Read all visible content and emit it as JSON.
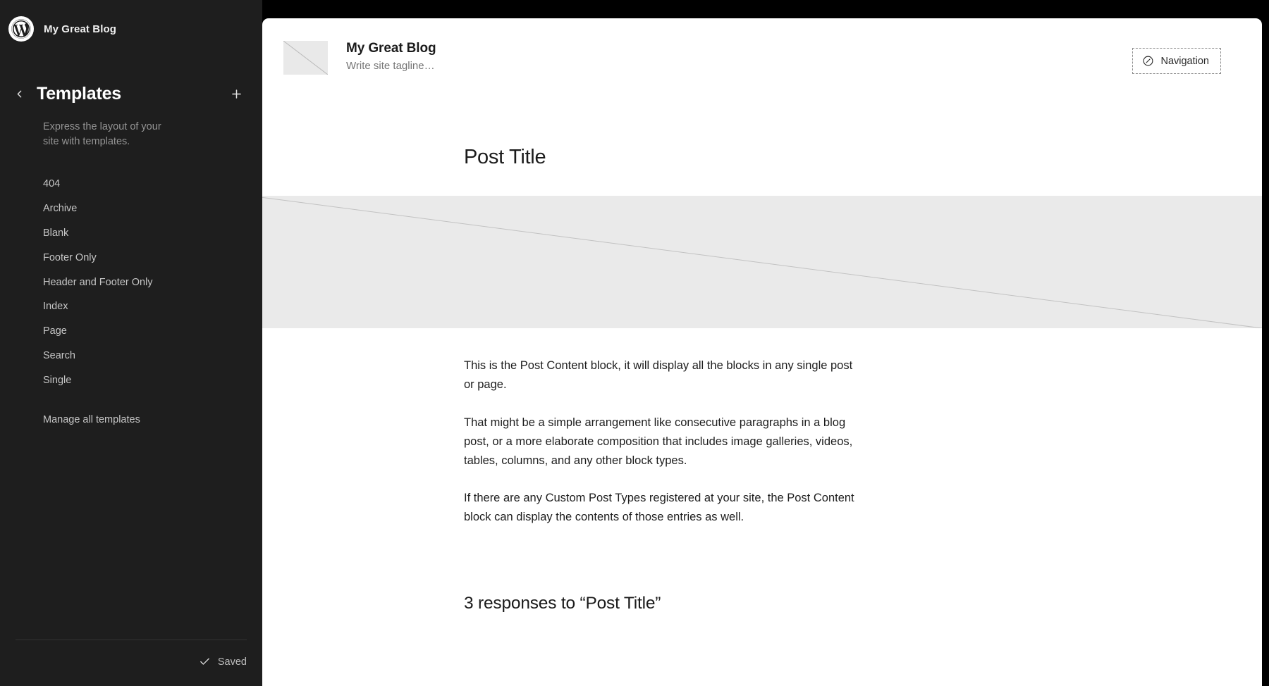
{
  "sidebar": {
    "site_name": "My Great Blog",
    "wp_logo_icon": "wordpress-logo-icon",
    "back_icon": "chevron-left-icon",
    "add_icon": "plus-icon",
    "panel_title": "Templates",
    "panel_description": "Express the layout of your site with templates.",
    "templates": [
      {
        "label": "404"
      },
      {
        "label": "Archive"
      },
      {
        "label": "Blank"
      },
      {
        "label": "Footer Only"
      },
      {
        "label": "Header and Footer Only"
      },
      {
        "label": "Index"
      },
      {
        "label": "Page"
      },
      {
        "label": "Search"
      },
      {
        "label": "Single"
      }
    ],
    "manage_all_label": "Manage all templates",
    "footer": {
      "check_icon": "checkmark-icon",
      "status_label": "Saved"
    }
  },
  "canvas": {
    "site_header": {
      "logo_placeholder_icon": "image-placeholder-icon",
      "site_title": "My Great Blog",
      "site_tagline": "Write site tagline…",
      "navigation_button": {
        "icon": "navigation-circle-slash-icon",
        "label": "Navigation"
      }
    },
    "post": {
      "title": "Post Title",
      "featured_image_icon": "image-placeholder-icon",
      "paragraphs": [
        "This is the Post Content block, it will display all the blocks in any single post or page.",
        "That might be a simple arrangement like consecutive paragraphs in a blog post, or a more elaborate composition that includes image galleries, videos, tables, columns, and any other block types.",
        "If there are any Custom Post Types registered at your site, the Post Content block can display the contents of those entries as well."
      ],
      "comments_heading": "3 responses to “Post Title”"
    }
  },
  "colors": {
    "frame": "#000000",
    "sidebar_bg": "#1e1e1e",
    "canvas_bg": "#ffffff",
    "placeholder_gray": "#eaeaea",
    "sidebar_text": "#c6c6c6",
    "sidebar_muted": "#949494"
  }
}
